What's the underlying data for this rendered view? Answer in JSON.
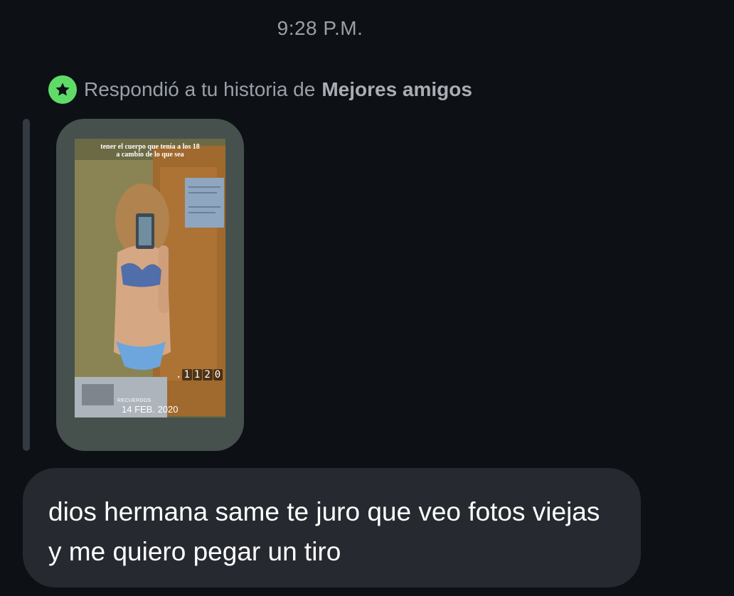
{
  "thread": {
    "timestamp": "9:28 P.M.",
    "reply_context": {
      "prefix": "Respondió a tu historia de",
      "audience": "Mejores amigos",
      "badge_icon": "star-icon",
      "badge_color": "#5fdc68"
    },
    "story": {
      "caption_line1": "tener el cuerpo que tenía a los 18",
      "caption_line2": "a cambio de lo que sea",
      "counter_prefix": ".",
      "counter_digits": [
        "1",
        "1",
        "2",
        "0"
      ],
      "memories_label": "RECUERDOS",
      "memories_date": "14 FEB. 2020"
    },
    "message": {
      "text": "dios hermana same te juro que veo fotos viejas y me quiero pegar un tiro"
    }
  }
}
